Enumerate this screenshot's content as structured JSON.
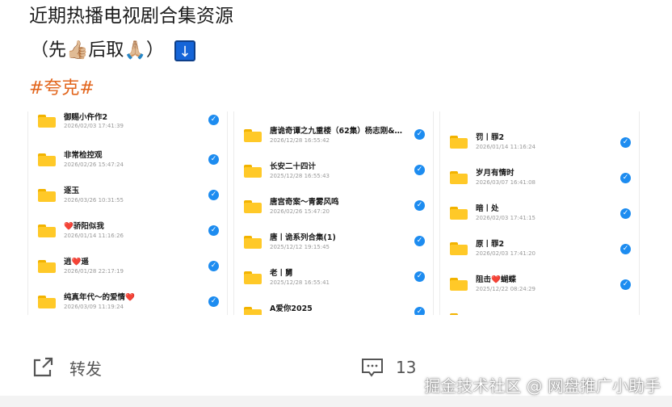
{
  "post": {
    "title": "近期热播电视剧合集资源",
    "line2_open": "（先",
    "line2_mid": "后取",
    "line2_close": "）",
    "emoji_thumb": "👍🏼",
    "emoji_pray": "🙏🏼",
    "arrow_symbol": "↓",
    "hashtag": "#夸克#"
  },
  "panels": [
    {
      "items": [
        {
          "name": "御赐小仵作2",
          "date": "2026/02/03 17:41:39"
        },
        {
          "name": "非常检控观",
          "date": "2026/02/26 15:47:24"
        },
        {
          "name": "逐玉",
          "date": "2026/03/26 10:31:55"
        },
        {
          "name": "❤️骄阳似我",
          "date": "2026/01/14 11:16:26"
        },
        {
          "name": "逍❤️遥",
          "date": "2026/01/28 22:17:19"
        },
        {
          "name": "纯真年代～的爱情❤️",
          "date": "2026/03/09 11:19:24"
        }
      ]
    },
    {
      "items": [
        {
          "name": "唐诡奇谭之九重楼（62集）杨志刚&…",
          "date": "2026/12/28 16:55:42"
        },
        {
          "name": "长安二十四计",
          "date": "2025/12/28 16:55:43"
        },
        {
          "name": "唐宫奇案～青雾风鸣",
          "date": "2026/02/26 15:47:20"
        },
        {
          "name": "唐丨诡系列合集(1)",
          "date": "2025/12/12 19:15:45"
        },
        {
          "name": "老丨舅",
          "date": "2025/12/28 16:55:41"
        },
        {
          "name": "A爱你2025",
          "date": ""
        }
      ]
    },
    {
      "items": [
        {
          "name": "罚丨罪2",
          "date": "2026/01/14 11:16:24"
        },
        {
          "name": "岁月有情时",
          "date": "2026/03/07 16:41:08"
        },
        {
          "name": "暗丨处",
          "date": "2026/02/03 17:41:15"
        },
        {
          "name": "原丨罪2",
          "date": "2026/02/03 17:41:20"
        },
        {
          "name": "阻击❤️蝴蝶",
          "date": "2025/12/22 08:24:29"
        },
        {
          "name": "",
          "date": ""
        }
      ]
    }
  ],
  "actions": {
    "share_label": "转发",
    "comment_count": "13"
  },
  "watermark": "掘金技术社区 @ 网盘推广小助手",
  "colors": {
    "hashtag": "#e2651c",
    "folder": "#ffc928",
    "check": "#1d8cf0",
    "arrow_box": "#1565d8"
  }
}
